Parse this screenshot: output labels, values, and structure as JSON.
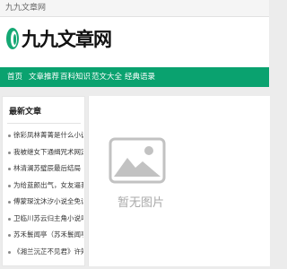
{
  "topbar": {
    "text": "九九文章网"
  },
  "header": {
    "site_name": "九九文章网",
    "logo_icon": "leaf-logo-icon"
  },
  "nav": {
    "color": "#0aa26f",
    "items": [
      {
        "label": "首页"
      },
      {
        "label": "文章推荐"
      },
      {
        "label": "百科知识"
      },
      {
        "label": "范文大全"
      },
      {
        "label": "经典语录"
      }
    ]
  },
  "sidebar": {
    "title": "最新文章",
    "items": [
      {
        "label": "徐彩凤林菁菁是什么小说"
      },
      {
        "label": "我被继女下通缉咒术网定"
      },
      {
        "label": "林清澜苏璧辰最后结局"
      },
      {
        "label": "为给蓝颜出气，女友逼我"
      },
      {
        "label": "傅蒙琛沈沐汐小说全免读"
      },
      {
        "label": "卫临川苏云归主角小说叫"
      },
      {
        "label": "苏禾鬟闻亭（苏禾鬟闻亭"
      },
      {
        "label": "《湘兰沅芷不见君》许知"
      }
    ]
  },
  "main": {
    "placeholder_text": "暂无图片",
    "placeholder_icon": "image-placeholder-icon"
  }
}
